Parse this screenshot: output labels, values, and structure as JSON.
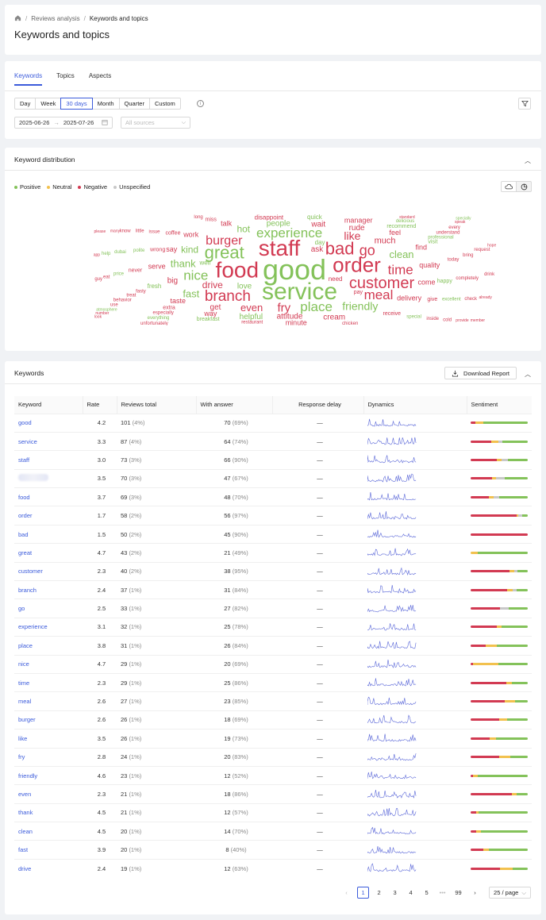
{
  "breadcrumb": {
    "items": [
      "Reviews analysis",
      "Keywords and topics"
    ]
  },
  "page_title": "Keywords and topics",
  "tabs": [
    "Keywords",
    "Topics",
    "Aspects"
  ],
  "period_buttons": [
    "Day",
    "Week",
    "30 days",
    "Month",
    "Quarter",
    "Custom"
  ],
  "period_active": "30 days",
  "date_range": {
    "start": "2025-06-26",
    "end": "2025-07-26"
  },
  "sources": {
    "placeholder": "All sources"
  },
  "distribution": {
    "title": "Keyword distribution",
    "legend": [
      {
        "label": "Positive",
        "color": "#84c25a"
      },
      {
        "label": "Neutral",
        "color": "#f2c14e"
      },
      {
        "label": "Negative",
        "color": "#d23a52"
      },
      {
        "label": "Unspecified",
        "color": "#c8c8c8"
      }
    ],
    "colors": {
      "positive": "#84c25a",
      "neutral": "#f2c14e",
      "negative": "#d23a52"
    },
    "cloud_words": [
      {
        "text": "good",
        "s": "p",
        "size": 36
      },
      {
        "text": "service",
        "s": "p",
        "size": 30
      },
      {
        "text": "staff",
        "s": "n",
        "size": 28
      },
      {
        "text": "food",
        "s": "n",
        "size": 28
      },
      {
        "text": "order",
        "s": "n",
        "size": 26
      },
      {
        "text": "bad",
        "s": "n",
        "size": 22
      },
      {
        "text": "great",
        "s": "p",
        "size": 22
      },
      {
        "text": "customer",
        "s": "n",
        "size": 20
      },
      {
        "text": "branch",
        "s": "n",
        "size": 19
      },
      {
        "text": "experience",
        "s": "p",
        "size": 17
      },
      {
        "text": "place",
        "s": "p",
        "size": 17
      },
      {
        "text": "nice",
        "s": "p",
        "size": 17
      },
      {
        "text": "time",
        "s": "n",
        "size": 17
      },
      {
        "text": "meal",
        "s": "n",
        "size": 17
      },
      {
        "text": "burger",
        "s": "n",
        "size": 16
      },
      {
        "text": "go",
        "s": "n",
        "size": 18
      },
      {
        "text": "like",
        "s": "n",
        "size": 14
      },
      {
        "text": "fry",
        "s": "n",
        "size": 15
      },
      {
        "text": "friendly",
        "s": "p",
        "size": 14
      },
      {
        "text": "even",
        "s": "n",
        "size": 13
      },
      {
        "text": "thank",
        "s": "p",
        "size": 13
      },
      {
        "text": "clean",
        "s": "p",
        "size": 13
      },
      {
        "text": "fast",
        "s": "p",
        "size": 13
      },
      {
        "text": "drive",
        "s": "n",
        "size": 12
      },
      {
        "text": "kind",
        "s": "p",
        "size": 12
      },
      {
        "text": "hot",
        "s": "p",
        "size": 12
      },
      {
        "text": "much",
        "s": "n",
        "size": 11
      },
      {
        "text": "quality",
        "s": "n",
        "size": 9
      },
      {
        "text": "attitude",
        "s": "n",
        "size": 10
      },
      {
        "text": "delivery",
        "s": "n",
        "size": 9
      },
      {
        "text": "people",
        "s": "p",
        "size": 10
      },
      {
        "text": "love",
        "s": "p",
        "size": 10
      },
      {
        "text": "minute",
        "s": "n",
        "size": 9
      },
      {
        "text": "come",
        "s": "n",
        "size": 9
      },
      {
        "text": "wait",
        "s": "n",
        "size": 10
      },
      {
        "text": "serve",
        "s": "n",
        "size": 9
      },
      {
        "text": "say",
        "s": "n",
        "size": 9
      },
      {
        "text": "work",
        "s": "n",
        "size": 9
      },
      {
        "text": "ask",
        "s": "n",
        "size": 10
      },
      {
        "text": "get",
        "s": "n",
        "size": 10
      },
      {
        "text": "talk",
        "s": "n",
        "size": 9
      },
      {
        "text": "feel",
        "s": "n",
        "size": 9
      },
      {
        "text": "find",
        "s": "n",
        "size": 9
      },
      {
        "text": "rude",
        "s": "n",
        "size": 10
      },
      {
        "text": "cream",
        "s": "n",
        "size": 10
      },
      {
        "text": "helpful",
        "s": "p",
        "size": 10
      },
      {
        "text": "way",
        "s": "n",
        "size": 9
      },
      {
        "text": "taste",
        "s": "n",
        "size": 9
      },
      {
        "text": "big",
        "s": "n",
        "size": 10
      },
      {
        "text": "need",
        "s": "n",
        "size": 8
      },
      {
        "text": "disappoint",
        "s": "n",
        "size": 8
      },
      {
        "text": "quick",
        "s": "p",
        "size": 8
      },
      {
        "text": "well",
        "s": "p",
        "size": 8
      },
      {
        "text": "receive",
        "s": "n",
        "size": 7
      },
      {
        "text": "wrong",
        "s": "n",
        "size": 7
      },
      {
        "text": "breakfast",
        "s": "p",
        "size": 7
      },
      {
        "text": "fresh",
        "s": "p",
        "size": 8
      },
      {
        "text": "happy",
        "s": "p",
        "size": 7
      },
      {
        "text": "recommend",
        "s": "p",
        "size": 7
      },
      {
        "text": "restaurant",
        "s": "n",
        "size": 6
      },
      {
        "text": "coffee",
        "s": "n",
        "size": 7
      },
      {
        "text": "visit",
        "s": "p",
        "size": 7
      },
      {
        "text": "extra",
        "s": "n",
        "size": 7
      },
      {
        "text": "chicken",
        "s": "n",
        "size": 6
      },
      {
        "text": "manager",
        "s": "n",
        "size": 9
      },
      {
        "text": "pay",
        "s": "n",
        "size": 7
      },
      {
        "text": "today",
        "s": "n",
        "size": 6
      },
      {
        "text": "never",
        "s": "n",
        "size": 7
      },
      {
        "text": "fasty",
        "s": "n",
        "size": 6
      },
      {
        "text": "polite",
        "s": "p",
        "size": 6
      },
      {
        "text": "delicious",
        "s": "p",
        "size": 6
      },
      {
        "text": "professional",
        "s": "p",
        "size": 6
      },
      {
        "text": "especially",
        "s": "n",
        "size": 6
      },
      {
        "text": "completely",
        "s": "n",
        "size": 6
      },
      {
        "text": "miss",
        "s": "n",
        "size": 7
      },
      {
        "text": "excellent",
        "s": "p",
        "size": 6
      },
      {
        "text": "special",
        "s": "p",
        "size": 6
      },
      {
        "text": "issue",
        "s": "n",
        "size": 6
      },
      {
        "text": "treat",
        "s": "n",
        "size": 6
      },
      {
        "text": "price",
        "s": "p",
        "size": 6
      },
      {
        "text": "bring",
        "s": "n",
        "size": 6
      },
      {
        "text": "dubai",
        "s": "p",
        "size": 6
      },
      {
        "text": "long",
        "s": "n",
        "size": 6
      },
      {
        "text": "understand",
        "s": "n",
        "size": 6
      },
      {
        "text": "everything",
        "s": "p",
        "size": 6
      },
      {
        "text": "little",
        "s": "n",
        "size": 6
      },
      {
        "text": "standard",
        "s": "n",
        "size": 5
      },
      {
        "text": "behavior",
        "s": "n",
        "size": 6
      },
      {
        "text": "inside",
        "s": "n",
        "size": 6
      },
      {
        "text": "check",
        "s": "n",
        "size": 6
      },
      {
        "text": "eat",
        "s": "n",
        "size": 6
      },
      {
        "text": "help",
        "s": "p",
        "size": 6
      },
      {
        "text": "every",
        "s": "n",
        "size": 6
      },
      {
        "text": "already",
        "s": "n",
        "size": 5
      },
      {
        "text": "many",
        "s": "n",
        "size": 5
      },
      {
        "text": "speak",
        "s": "n",
        "size": 5
      },
      {
        "text": "give",
        "s": "n",
        "size": 7
      },
      {
        "text": "unfortunately",
        "s": "n",
        "size": 6
      },
      {
        "text": "request",
        "s": "n",
        "size": 6
      },
      {
        "text": "provide",
        "s": "n",
        "size": 5
      },
      {
        "text": "atmosphere",
        "s": "p",
        "size": 5
      },
      {
        "text": "specially",
        "s": "p",
        "size": 5
      },
      {
        "text": "please",
        "s": "n",
        "size": 5
      },
      {
        "text": "hope",
        "s": "n",
        "size": 5
      },
      {
        "text": "number",
        "s": "n",
        "size": 5
      },
      {
        "text": "member",
        "s": "n",
        "size": 5
      },
      {
        "text": "ketchup",
        "s": "n",
        "size": 5
      },
      {
        "text": "nugget",
        "s": "n",
        "size": 5
      },
      {
        "text": "drink",
        "s": "n",
        "size": 6
      },
      {
        "text": "guy",
        "s": "n",
        "size": 6
      },
      {
        "text": "know",
        "s": "n",
        "size": 6
      },
      {
        "text": "look",
        "s": "n",
        "size": 5
      },
      {
        "text": "table",
        "s": "n",
        "size": 5
      },
      {
        "text": "perfect",
        "s": "p",
        "size": 5
      },
      {
        "text": "location",
        "s": "p",
        "size": 5
      },
      {
        "text": "extremely",
        "s": "n",
        "size": 5
      },
      {
        "text": "sometimes",
        "s": "n",
        "size": 5
      },
      {
        "text": "amazing",
        "s": "p",
        "size": 5
      },
      {
        "text": "cold",
        "s": "n",
        "size": 6
      },
      {
        "text": "app",
        "s": "n",
        "size": 5
      },
      {
        "text": "day",
        "s": "p",
        "size": 8
      },
      {
        "text": "use",
        "s": "n",
        "size": 6
      }
    ]
  },
  "keywords": {
    "title": "Keywords",
    "download_label": "Download Report",
    "columns": [
      "Keyword",
      "Rate",
      "Reviews total",
      "With answer",
      "Response delay",
      "Dynamics",
      "Sentiment"
    ],
    "rows": [
      {
        "keyword": "good",
        "rate": "4.2",
        "total": "101",
        "total_pct": "(4%)",
        "answered": "70",
        "answered_pct": "(69%)",
        "delay": "—",
        "sent": [
          8,
          14,
          0,
          78
        ]
      },
      {
        "keyword": "service",
        "rate": "3.3",
        "total": "87",
        "total_pct": "(4%)",
        "answered": "64",
        "answered_pct": "(74%)",
        "delay": "—",
        "sent": [
          36,
          12,
          8,
          44
        ]
      },
      {
        "keyword": "staff",
        "rate": "3.0",
        "total": "73",
        "total_pct": "(3%)",
        "answered": "66",
        "answered_pct": "(90%)",
        "delay": "—",
        "sent": [
          46,
          8,
          12,
          34
        ]
      },
      {
        "keyword": "",
        "blurred": true,
        "rate": "3.5",
        "total": "70",
        "total_pct": "(3%)",
        "answered": "47",
        "answered_pct": "(67%)",
        "delay": "—",
        "sent": [
          38,
          6,
          16,
          40
        ]
      },
      {
        "keyword": "food",
        "rate": "3.7",
        "total": "69",
        "total_pct": "(3%)",
        "answered": "48",
        "answered_pct": "(70%)",
        "delay": "—",
        "sent": [
          32,
          8,
          10,
          50
        ]
      },
      {
        "keyword": "order",
        "rate": "1.7",
        "total": "58",
        "total_pct": "(2%)",
        "answered": "56",
        "answered_pct": "(97%)",
        "delay": "—",
        "sent": [
          80,
          4,
          6,
          10
        ]
      },
      {
        "keyword": "bad",
        "rate": "1.5",
        "total": "50",
        "total_pct": "(2%)",
        "answered": "45",
        "answered_pct": "(90%)",
        "delay": "—",
        "sent": [
          100,
          0,
          0,
          0
        ]
      },
      {
        "keyword": "great",
        "rate": "4.7",
        "total": "43",
        "total_pct": "(2%)",
        "answered": "21",
        "answered_pct": "(49%)",
        "delay": "—",
        "sent": [
          0,
          12,
          0,
          88
        ]
      },
      {
        "keyword": "customer",
        "rate": "2.3",
        "total": "40",
        "total_pct": "(2%)",
        "answered": "38",
        "answered_pct": "(95%)",
        "delay": "—",
        "sent": [
          68,
          8,
          6,
          18
        ]
      },
      {
        "keyword": "branch",
        "rate": "2.4",
        "total": "37",
        "total_pct": "(1%)",
        "answered": "31",
        "answered_pct": "(84%)",
        "delay": "—",
        "sent": [
          64,
          10,
          6,
          20
        ]
      },
      {
        "keyword": "go",
        "rate": "2.5",
        "total": "33",
        "total_pct": "(1%)",
        "answered": "27",
        "answered_pct": "(82%)",
        "delay": "—",
        "sent": [
          52,
          0,
          14,
          34
        ]
      },
      {
        "keyword": "experience",
        "rate": "3.1",
        "total": "32",
        "total_pct": "(1%)",
        "answered": "25",
        "answered_pct": "(78%)",
        "delay": "—",
        "sent": [
          46,
          8,
          0,
          46
        ]
      },
      {
        "keyword": "place",
        "rate": "3.8",
        "total": "31",
        "total_pct": "(1%)",
        "answered": "26",
        "answered_pct": "(84%)",
        "delay": "—",
        "sent": [
          26,
          20,
          0,
          54
        ]
      },
      {
        "keyword": "nice",
        "rate": "4.7",
        "total": "29",
        "total_pct": "(1%)",
        "answered": "20",
        "answered_pct": "(69%)",
        "delay": "—",
        "sent": [
          4,
          44,
          0,
          52
        ]
      },
      {
        "keyword": "time",
        "rate": "2.3",
        "total": "29",
        "total_pct": "(1%)",
        "answered": "25",
        "answered_pct": "(86%)",
        "delay": "—",
        "sent": [
          62,
          10,
          0,
          28
        ]
      },
      {
        "keyword": "meal",
        "rate": "2.6",
        "total": "27",
        "total_pct": "(1%)",
        "answered": "23",
        "answered_pct": "(85%)",
        "delay": "—",
        "sent": [
          60,
          18,
          0,
          22
        ]
      },
      {
        "keyword": "burger",
        "rate": "2.6",
        "total": "26",
        "total_pct": "(1%)",
        "answered": "18",
        "answered_pct": "(69%)",
        "delay": "—",
        "sent": [
          50,
          14,
          0,
          36
        ]
      },
      {
        "keyword": "like",
        "rate": "3.5",
        "total": "26",
        "total_pct": "(1%)",
        "answered": "19",
        "answered_pct": "(73%)",
        "delay": "—",
        "sent": [
          34,
          10,
          0,
          56
        ]
      },
      {
        "keyword": "fry",
        "rate": "2.8",
        "total": "24",
        "total_pct": "(1%)",
        "answered": "20",
        "answered_pct": "(83%)",
        "delay": "—",
        "sent": [
          50,
          20,
          0,
          30
        ]
      },
      {
        "keyword": "friendly",
        "rate": "4.6",
        "total": "23",
        "total_pct": "(1%)",
        "answered": "12",
        "answered_pct": "(52%)",
        "delay": "—",
        "sent": [
          4,
          8,
          0,
          88
        ]
      },
      {
        "keyword": "even",
        "rate": "2.3",
        "total": "21",
        "total_pct": "(1%)",
        "answered": "18",
        "answered_pct": "(86%)",
        "delay": "—",
        "sent": [
          72,
          8,
          0,
          20
        ]
      },
      {
        "keyword": "thank",
        "rate": "4.5",
        "total": "21",
        "total_pct": "(1%)",
        "answered": "12",
        "answered_pct": "(57%)",
        "delay": "—",
        "sent": [
          10,
          4,
          0,
          86
        ]
      },
      {
        "keyword": "clean",
        "rate": "4.5",
        "total": "20",
        "total_pct": "(1%)",
        "answered": "14",
        "answered_pct": "(70%)",
        "delay": "—",
        "sent": [
          10,
          8,
          0,
          82
        ]
      },
      {
        "keyword": "fast",
        "rate": "3.9",
        "total": "20",
        "total_pct": "(1%)",
        "answered": "8",
        "answered_pct": "(40%)",
        "delay": "—",
        "sent": [
          22,
          10,
          0,
          68
        ]
      },
      {
        "keyword": "drive",
        "rate": "2.4",
        "total": "19",
        "total_pct": "(1%)",
        "answered": "12",
        "answered_pct": "(63%)",
        "delay": "—",
        "sent": [
          52,
          22,
          0,
          26
        ]
      }
    ]
  },
  "pagination": {
    "pages": [
      "1",
      "2",
      "3",
      "4",
      "5",
      "•••",
      "99"
    ],
    "active": "1",
    "page_size": "25 / page"
  }
}
